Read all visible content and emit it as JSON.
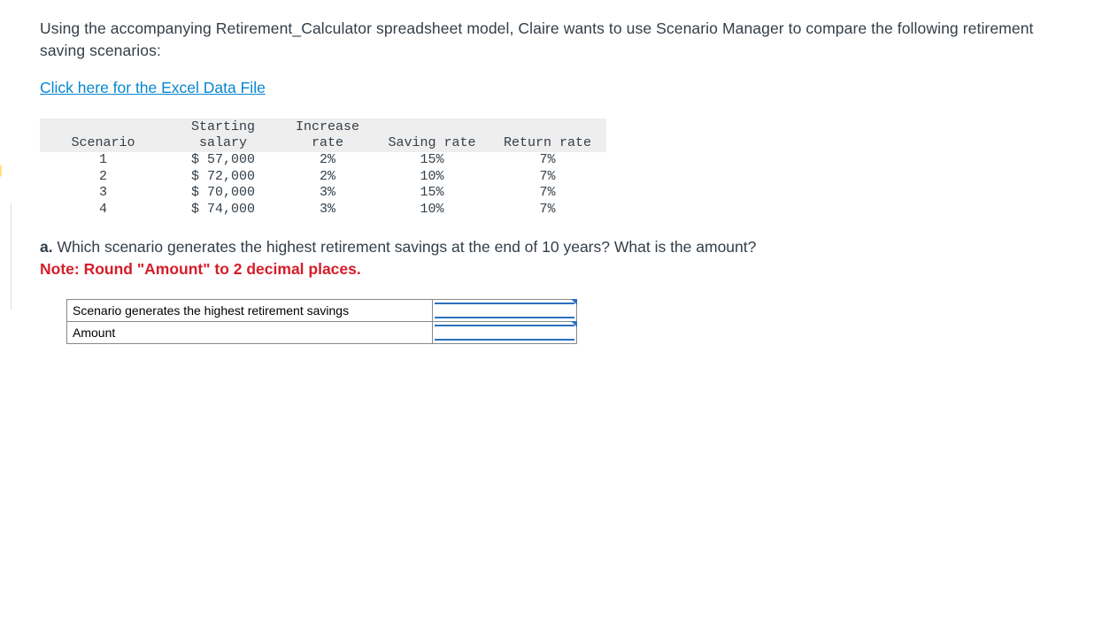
{
  "intro": "Using the accompanying Retirement_Calculator spreadsheet model, Claire wants to use Scenario Manager to compare the following retirement saving scenarios:",
  "file_link": "Click here for the Excel Data File",
  "table": {
    "headers": {
      "scenario_l1": "",
      "scenario_l2": "Scenario",
      "salary_l1": "Starting",
      "salary_l2": "salary",
      "increase_l1": "Increase",
      "increase_l2": "rate",
      "saving": "Saving rate",
      "return": "Return rate"
    },
    "rows": [
      {
        "scenario": "1",
        "salary": "$ 57,000",
        "increase": "2%",
        "saving": "15%",
        "ret": "7%"
      },
      {
        "scenario": "2",
        "salary": "$ 72,000",
        "increase": "2%",
        "saving": "10%",
        "ret": "7%"
      },
      {
        "scenario": "3",
        "salary": "$ 70,000",
        "increase": "3%",
        "saving": "15%",
        "ret": "7%"
      },
      {
        "scenario": "4",
        "salary": "$ 74,000",
        "increase": "3%",
        "saving": "10%",
        "ret": "7%"
      }
    ]
  },
  "question": {
    "tag": "a.",
    "text": " Which scenario generates the highest retirement savings at the end of 10 years? What is the amount?",
    "note": "Note: Round \"Amount\" to 2 decimal places."
  },
  "answer_table": {
    "row1_label": "Scenario generates the highest retirement savings",
    "row2_label": "Amount",
    "row1_value": "",
    "row2_value": ""
  }
}
